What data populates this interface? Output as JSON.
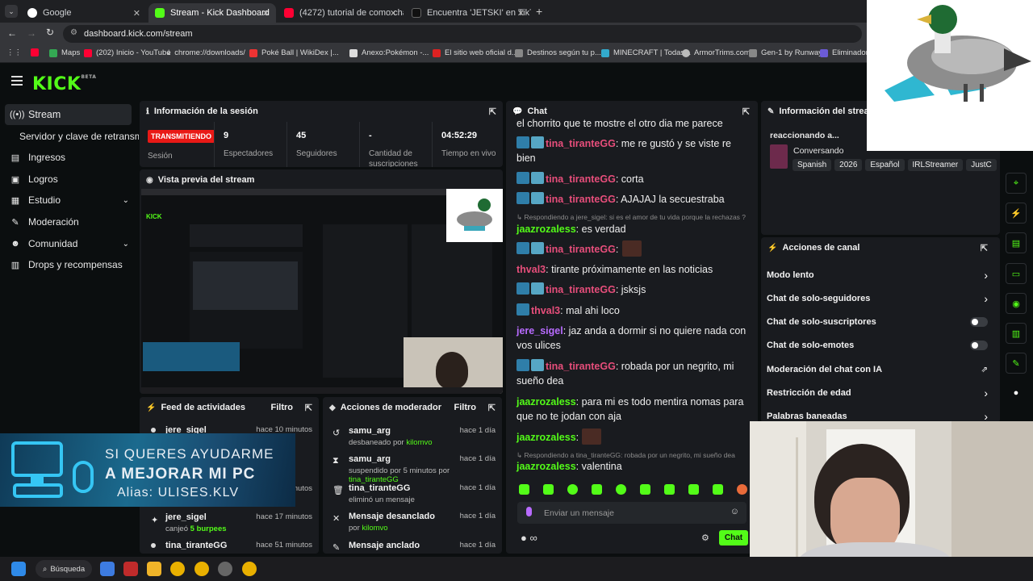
{
  "browser": {
    "tabs": [
      {
        "label": "Google",
        "active": false
      },
      {
        "label": "Stream - Kick Dashboard",
        "active": true
      },
      {
        "label": "(4272) tutorial de como chamu",
        "active": false
      },
      {
        "label": "Encuentra 'JETSKI' en TikTok | B",
        "active": false
      }
    ],
    "url": "dashboard.kick.com/stream",
    "bookmarks": [
      "Maps",
      "(202) Inicio - YouTube",
      "chrome://downloads/",
      "Poké Ball | WikiDex |...",
      "Anexo:Pokémon -...",
      "El sitio web oficial d...",
      "Destinos según tu p...",
      "MINECRAFT | Todas...",
      "ArmorTrims.com",
      "Gen-1 by Runway",
      "Eliminador de"
    ]
  },
  "brand": {
    "logo": "KICK",
    "beta": "BETA",
    "accent": "#53fc18"
  },
  "sidebar": {
    "items": [
      {
        "label": "Stream",
        "icon": "broadcast-icon"
      },
      {
        "label": "Servidor y clave de retransm"
      },
      {
        "label": "Ingresos",
        "icon": "money-icon"
      },
      {
        "label": "Logros",
        "icon": "trophy-icon"
      },
      {
        "label": "Estudio",
        "icon": "studio-icon"
      },
      {
        "label": "Moderación",
        "icon": "wrench-icon"
      },
      {
        "label": "Comunidad",
        "icon": "users-icon"
      },
      {
        "label": "Drops y recompensas",
        "icon": "gift-icon"
      }
    ]
  },
  "session": {
    "title": "Información de la sesión",
    "status": "TRANSMITIENDO",
    "status_label": "Sesión",
    "stats": [
      {
        "value": "9",
        "label": "Espectadores"
      },
      {
        "value": "45",
        "label": "Seguidores"
      },
      {
        "value": "-",
        "label": "Cantidad de suscripciones"
      },
      {
        "value": "04:52:29",
        "label": "Tiempo en vivo"
      }
    ]
  },
  "preview": {
    "title": "Vista previa del stream"
  },
  "feed": {
    "title": "Feed de actividades",
    "filter": "Filtro",
    "items": [
      {
        "name": "jere_sigel",
        "time": "hace 10 minutos",
        "sub": ""
      },
      {
        "name": "jere_sigel",
        "time": "hace 17 minutos",
        "sub_prefix": "canjeó ",
        "sub_hl": "5 burpees"
      },
      {
        "name": "tina_tiranteGG",
        "time": "hace 51 minutos"
      }
    ],
    "hidden_time": "minutos"
  },
  "modactions": {
    "title": "Acciones de moderador",
    "filter": "Filtro",
    "items": [
      {
        "name": "samu_arg",
        "time": "hace 1 día",
        "sub": "desbaneado por ",
        "by": "kilomvo"
      },
      {
        "name": "samu_arg",
        "time": "hace 1 día",
        "sub": "suspendido por 5 minutos por ",
        "by": "tina_tiranteGG"
      },
      {
        "name": "tina_tiranteGG",
        "time": "hace 1 día",
        "sub": "eliminó un mensaje",
        "by": ""
      },
      {
        "name": "Mensaje desanclado",
        "time": "hace 1 día",
        "sub": "por ",
        "by": "kilomvo"
      },
      {
        "name": "Mensaje anclado",
        "time": "hace 1 día",
        "sub": "",
        "by": ""
      }
    ]
  },
  "chat": {
    "title": "Chat",
    "messages": [
      {
        "user": "",
        "text": "el chorrito que te mostre el otro dia me parece"
      },
      {
        "user": "tina_tiranteGG",
        "text": "me re gustó y se viste re bien"
      },
      {
        "user": "tina_tiranteGG",
        "text": "corta"
      },
      {
        "user": "tina_tiranteGG",
        "text": "AJAJAJ la secuestraba"
      },
      {
        "reply": "Respondiendo a jere_sigel: si es el amor de tu vida porque la rechazas ?"
      },
      {
        "user": "jaazrozaless",
        "text": "es verdad"
      },
      {
        "user": "tina_tiranteGG",
        "text": ""
      },
      {
        "user": "thval3",
        "text": "tirante próximamente en las noticias"
      },
      {
        "user": "tina_tiranteGG",
        "text": "jsksjs"
      },
      {
        "user": "thval3",
        "text": "mal ahi loco"
      },
      {
        "user": "jere_sigel",
        "text": "jaz anda a dormir si no quiere nada con vos ulices"
      },
      {
        "user": "tina_tiranteGG",
        "text": "robada por un negrito, mi sueño dea"
      },
      {
        "user": "jaazrozaless",
        "text": "para mi es todo mentira nomas para que no te jodan con aja"
      },
      {
        "user": "jaazrozaless",
        "text": ""
      },
      {
        "reply": "Respondiendo a tina_tiranteGG: robada por un negrito, mi sueño dea"
      },
      {
        "user": "jaazrozaless",
        "text": "valentina"
      }
    ],
    "input_placeholder": "Enviar un mensaje",
    "send_label": "Chat",
    "infinity": "∞"
  },
  "streaminfo": {
    "title": "Información del stream",
    "stream_title": "reaccionando a...",
    "category": "Conversando",
    "tags": [
      "Spanish",
      "2026",
      "Español",
      "IRLStreamer",
      "JustC"
    ]
  },
  "channel": {
    "title": "Acciones de canal",
    "items": [
      {
        "label": "Modo lento",
        "control": "chevron"
      },
      {
        "label": "Chat de solo-seguidores",
        "control": "chevron"
      },
      {
        "label": "Chat de solo-suscriptores",
        "control": "toggle"
      },
      {
        "label": "Chat de solo-emotes",
        "control": "toggle"
      },
      {
        "label": "Moderación del chat con IA",
        "control": "external"
      },
      {
        "label": "Restricción de edad",
        "control": "chevron"
      },
      {
        "label": "Palabras baneadas",
        "control": "chevron"
      }
    ]
  },
  "overlay": {
    "line1": "SI QUERES AYUDARME",
    "line2": "A MEJORAR MI PC",
    "line3": "Alias: ULISES.KLV"
  },
  "taskbar": {
    "search": "Búsqueda"
  }
}
